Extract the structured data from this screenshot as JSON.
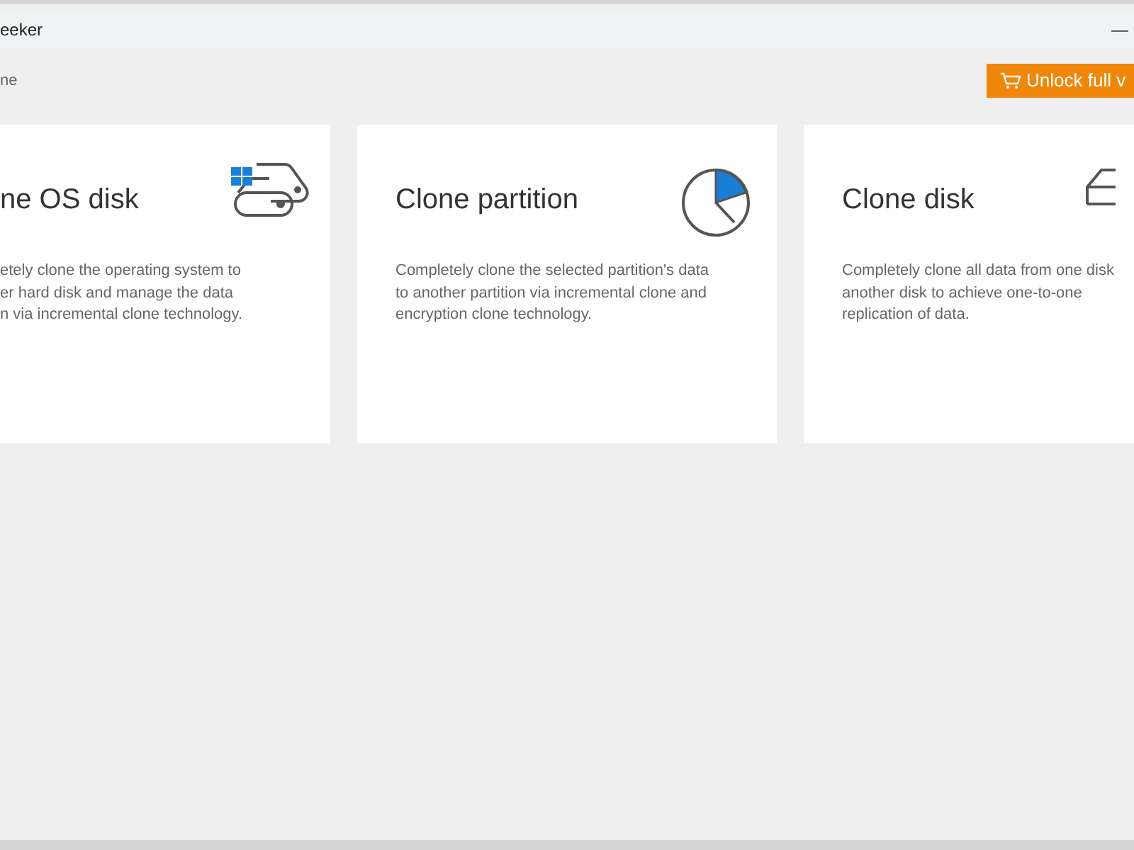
{
  "window": {
    "title": "eeker",
    "minimize": "—"
  },
  "breadcrumb": "ne",
  "unlock_button": {
    "label": "Unlock full v"
  },
  "cards": [
    {
      "kind": "os",
      "title": "ne OS disk",
      "description": [
        "etely clone the operating system to",
        "er hard disk and manage the data",
        "n via incremental clone technology."
      ]
    },
    {
      "kind": "partition",
      "title": "Clone partition",
      "description": [
        "Completely clone the selected partition's data",
        "to another partition via incremental clone and",
        "encryption clone technology."
      ]
    },
    {
      "kind": "disk",
      "title": "Clone disk",
      "description": [
        "Completely clone all data from one disk",
        "another disk to achieve one-to-one",
        "replication of data."
      ]
    }
  ]
}
